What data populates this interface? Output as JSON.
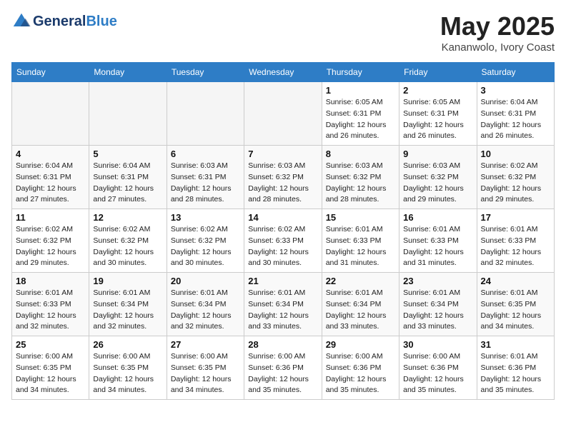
{
  "header": {
    "logo_line1": "General",
    "logo_line2": "Blue",
    "month": "May 2025",
    "location": "Kananwolo, Ivory Coast"
  },
  "weekdays": [
    "Sunday",
    "Monday",
    "Tuesday",
    "Wednesday",
    "Thursday",
    "Friday",
    "Saturday"
  ],
  "weeks": [
    [
      {
        "day": "",
        "info": "",
        "empty": true
      },
      {
        "day": "",
        "info": "",
        "empty": true
      },
      {
        "day": "",
        "info": "",
        "empty": true
      },
      {
        "day": "",
        "info": "",
        "empty": true
      },
      {
        "day": "1",
        "info": "Sunrise: 6:05 AM\nSunset: 6:31 PM\nDaylight: 12 hours\nand 26 minutes."
      },
      {
        "day": "2",
        "info": "Sunrise: 6:05 AM\nSunset: 6:31 PM\nDaylight: 12 hours\nand 26 minutes."
      },
      {
        "day": "3",
        "info": "Sunrise: 6:04 AM\nSunset: 6:31 PM\nDaylight: 12 hours\nand 26 minutes."
      }
    ],
    [
      {
        "day": "4",
        "info": "Sunrise: 6:04 AM\nSunset: 6:31 PM\nDaylight: 12 hours\nand 27 minutes."
      },
      {
        "day": "5",
        "info": "Sunrise: 6:04 AM\nSunset: 6:31 PM\nDaylight: 12 hours\nand 27 minutes."
      },
      {
        "day": "6",
        "info": "Sunrise: 6:03 AM\nSunset: 6:31 PM\nDaylight: 12 hours\nand 28 minutes."
      },
      {
        "day": "7",
        "info": "Sunrise: 6:03 AM\nSunset: 6:32 PM\nDaylight: 12 hours\nand 28 minutes."
      },
      {
        "day": "8",
        "info": "Sunrise: 6:03 AM\nSunset: 6:32 PM\nDaylight: 12 hours\nand 28 minutes."
      },
      {
        "day": "9",
        "info": "Sunrise: 6:03 AM\nSunset: 6:32 PM\nDaylight: 12 hours\nand 29 minutes."
      },
      {
        "day": "10",
        "info": "Sunrise: 6:02 AM\nSunset: 6:32 PM\nDaylight: 12 hours\nand 29 minutes."
      }
    ],
    [
      {
        "day": "11",
        "info": "Sunrise: 6:02 AM\nSunset: 6:32 PM\nDaylight: 12 hours\nand 29 minutes."
      },
      {
        "day": "12",
        "info": "Sunrise: 6:02 AM\nSunset: 6:32 PM\nDaylight: 12 hours\nand 30 minutes."
      },
      {
        "day": "13",
        "info": "Sunrise: 6:02 AM\nSunset: 6:32 PM\nDaylight: 12 hours\nand 30 minutes."
      },
      {
        "day": "14",
        "info": "Sunrise: 6:02 AM\nSunset: 6:33 PM\nDaylight: 12 hours\nand 30 minutes."
      },
      {
        "day": "15",
        "info": "Sunrise: 6:01 AM\nSunset: 6:33 PM\nDaylight: 12 hours\nand 31 minutes."
      },
      {
        "day": "16",
        "info": "Sunrise: 6:01 AM\nSunset: 6:33 PM\nDaylight: 12 hours\nand 31 minutes."
      },
      {
        "day": "17",
        "info": "Sunrise: 6:01 AM\nSunset: 6:33 PM\nDaylight: 12 hours\nand 32 minutes."
      }
    ],
    [
      {
        "day": "18",
        "info": "Sunrise: 6:01 AM\nSunset: 6:33 PM\nDaylight: 12 hours\nand 32 minutes."
      },
      {
        "day": "19",
        "info": "Sunrise: 6:01 AM\nSunset: 6:34 PM\nDaylight: 12 hours\nand 32 minutes."
      },
      {
        "day": "20",
        "info": "Sunrise: 6:01 AM\nSunset: 6:34 PM\nDaylight: 12 hours\nand 32 minutes."
      },
      {
        "day": "21",
        "info": "Sunrise: 6:01 AM\nSunset: 6:34 PM\nDaylight: 12 hours\nand 33 minutes."
      },
      {
        "day": "22",
        "info": "Sunrise: 6:01 AM\nSunset: 6:34 PM\nDaylight: 12 hours\nand 33 minutes."
      },
      {
        "day": "23",
        "info": "Sunrise: 6:01 AM\nSunset: 6:34 PM\nDaylight: 12 hours\nand 33 minutes."
      },
      {
        "day": "24",
        "info": "Sunrise: 6:01 AM\nSunset: 6:35 PM\nDaylight: 12 hours\nand 34 minutes."
      }
    ],
    [
      {
        "day": "25",
        "info": "Sunrise: 6:00 AM\nSunset: 6:35 PM\nDaylight: 12 hours\nand 34 minutes."
      },
      {
        "day": "26",
        "info": "Sunrise: 6:00 AM\nSunset: 6:35 PM\nDaylight: 12 hours\nand 34 minutes."
      },
      {
        "day": "27",
        "info": "Sunrise: 6:00 AM\nSunset: 6:35 PM\nDaylight: 12 hours\nand 34 minutes."
      },
      {
        "day": "28",
        "info": "Sunrise: 6:00 AM\nSunset: 6:36 PM\nDaylight: 12 hours\nand 35 minutes."
      },
      {
        "day": "29",
        "info": "Sunrise: 6:00 AM\nSunset: 6:36 PM\nDaylight: 12 hours\nand 35 minutes."
      },
      {
        "day": "30",
        "info": "Sunrise: 6:00 AM\nSunset: 6:36 PM\nDaylight: 12 hours\nand 35 minutes."
      },
      {
        "day": "31",
        "info": "Sunrise: 6:01 AM\nSunset: 6:36 PM\nDaylight: 12 hours\nand 35 minutes."
      }
    ]
  ]
}
